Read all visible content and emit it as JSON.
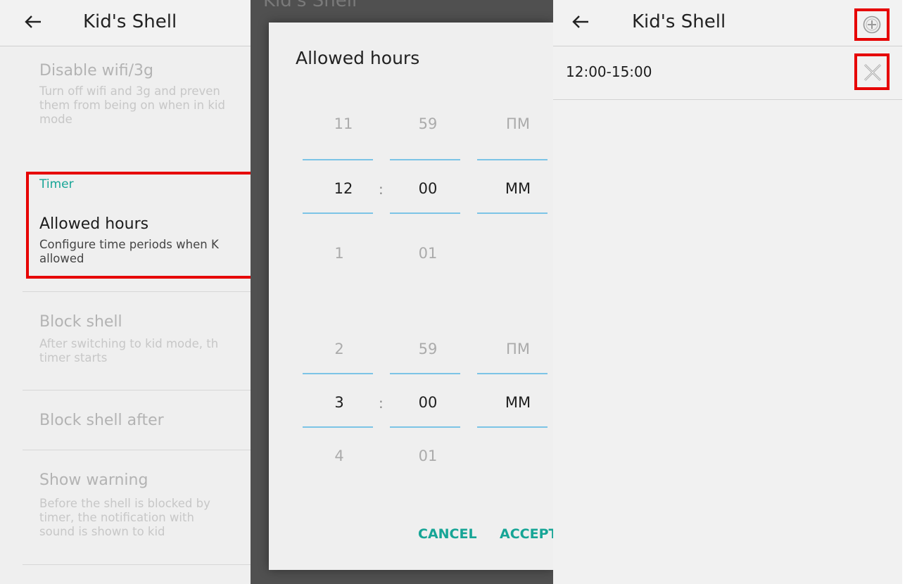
{
  "app_title": "Kid's Shell",
  "panel1": {
    "items": [
      {
        "title": "Disable wifi/3g",
        "summary": "Turn off wifi and 3g and preven\nthem from being on when in kid\nmode"
      },
      {
        "category": "Timer",
        "title": "Allowed hours",
        "summary": "Configure time periods when K\nallowed"
      },
      {
        "title": "Block shell",
        "summary": "After switching to kid mode, th\ntimer starts"
      },
      {
        "title": "Block shell after"
      },
      {
        "title": "Show warning",
        "summary": "Before the shell is blocked by\ntimer, the notification with\nsound is shown to kid"
      }
    ]
  },
  "dialog": {
    "title": "Allowed hours",
    "start_picker": {
      "prev": {
        "hour": "11",
        "minute": "59",
        "ampm": "ПМ"
      },
      "selected": {
        "hour": "12",
        "minute": "00",
        "ampm": "ММ"
      },
      "next": {
        "hour": "1",
        "minute": "01"
      }
    },
    "end_picker": {
      "prev": {
        "hour": "2",
        "minute": "59",
        "ampm": "ПМ"
      },
      "selected": {
        "hour": "3",
        "minute": "00",
        "ampm": "ММ"
      },
      "next": {
        "hour": "4",
        "minute": "01"
      }
    },
    "colon": ":",
    "cancel_label": "CANCEL",
    "accept_label": "ACCEPT"
  },
  "panel3": {
    "periods": [
      {
        "value": "12:00-15:00"
      }
    ]
  },
  "icons": {
    "back": "arrow-left-icon",
    "add": "plus-circle-icon",
    "delete": "close-x-icon"
  },
  "colors": {
    "accent": "#16a596",
    "highlight": "#e60000",
    "picker_line": "#7cc4e6"
  }
}
